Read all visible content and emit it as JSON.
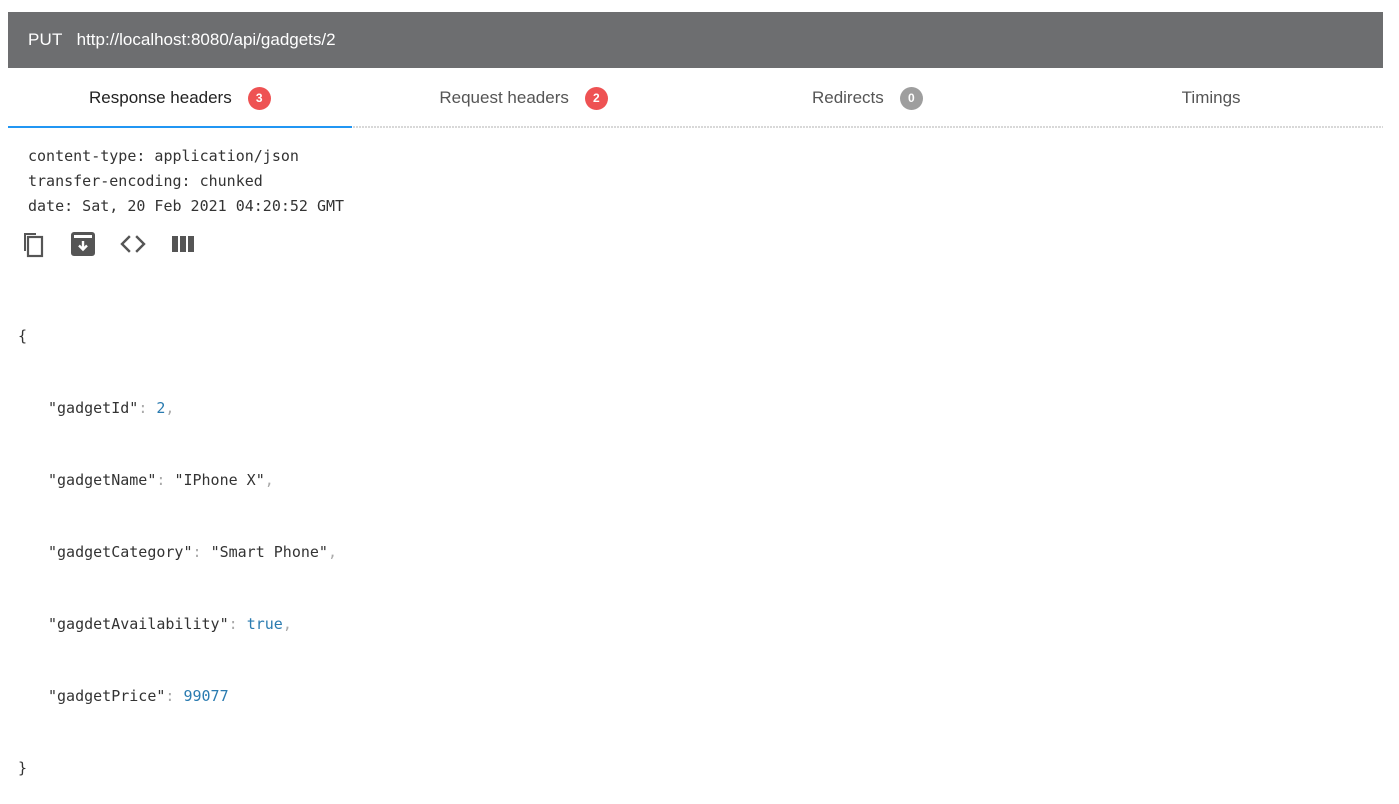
{
  "request": {
    "method": "PUT",
    "url": "http://localhost:8080/api/gadgets/2"
  },
  "tabs": [
    {
      "label": "Response headers",
      "badge": "3",
      "badge_color": "#ee5253",
      "active": true
    },
    {
      "label": "Request headers",
      "badge": "2",
      "badge_color": "#ee5253",
      "active": false
    },
    {
      "label": "Redirects",
      "badge": "0",
      "badge_color": "#9e9e9e",
      "active": false
    },
    {
      "label": "Timings",
      "badge": null,
      "active": false
    }
  ],
  "response_headers": [
    "content-type: application/json",
    "transfer-encoding: chunked",
    "date: Sat, 20 Feb 2021 04:20:52 GMT"
  ],
  "actions": [
    {
      "name": "copy-icon"
    },
    {
      "name": "save-icon"
    },
    {
      "name": "code-view-icon"
    },
    {
      "name": "columns-view-icon"
    }
  ],
  "json_body": {
    "open": "{",
    "close": "}",
    "fields": [
      {
        "key": "\"gadgetId\"",
        "value": "2",
        "type": "num",
        "comma": ","
      },
      {
        "key": "\"gadgetName\"",
        "value": "\"IPhone X\"",
        "type": "str",
        "comma": ","
      },
      {
        "key": "\"gadgetCategory\"",
        "value": "\"Smart Phone\"",
        "type": "str",
        "comma": ","
      },
      {
        "key": "\"gagdetAvailability\"",
        "value": "true",
        "type": "bool",
        "comma": ","
      },
      {
        "key": "\"gadgetPrice\"",
        "value": "99077",
        "type": "num",
        "comma": ""
      }
    ]
  },
  "colors": {
    "accent": "#2196f3",
    "bar": "#6d6e70"
  }
}
